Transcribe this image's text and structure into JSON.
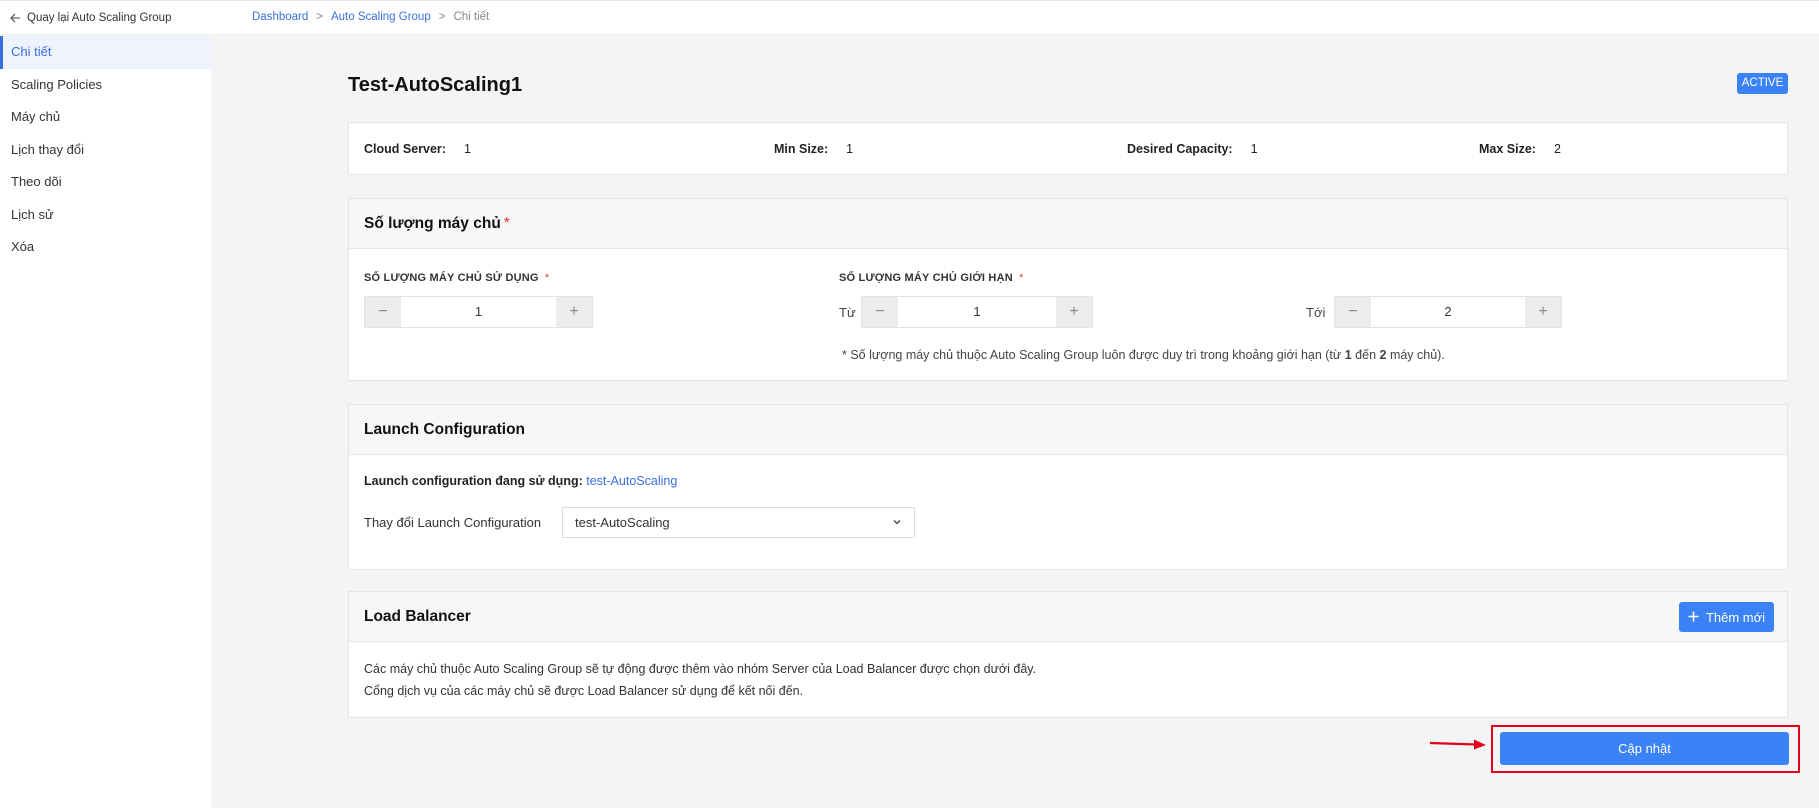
{
  "topbar": {
    "back_label": "Quay lại Auto Scaling Group",
    "breadcrumb": [
      "Dashboard",
      "Auto Scaling Group",
      "Chi tiết"
    ],
    "separator": ">"
  },
  "sidebar": {
    "items": [
      {
        "label": "Chi tiết",
        "active": true
      },
      {
        "label": "Scaling Policies"
      },
      {
        "label": "Máy chủ"
      },
      {
        "label": "Lịch thay đổi"
      },
      {
        "label": "Theo dõi"
      },
      {
        "label": "Lịch sử"
      },
      {
        "label": "Xóa"
      }
    ]
  },
  "page": {
    "title": "Test-AutoScaling1",
    "status": "ACTIVE"
  },
  "stats": {
    "cloud_server_label": "Cloud Server:",
    "cloud_server": "1",
    "min_size_label": "Min Size:",
    "min_size": "1",
    "desired_label": "Desired Capacity:",
    "desired": "1",
    "max_size_label": "Max Size:",
    "max_size": "2"
  },
  "quantity": {
    "title": "Số lượng máy chủ",
    "required_mark": "*",
    "in_use_label": "SỐ LƯỢNG MÁY CHỦ SỬ DỤNG",
    "in_use_value": "1",
    "limit_label": "SỐ LƯỢNG MÁY CHỦ GIỚI HẠN",
    "from_label": "Từ",
    "from_value": "1",
    "to_label": "Tới",
    "to_value": "2",
    "note_prefix": "* Số lượng máy chủ thuộc Auto Scaling Group luôn được duy trì trong khoảng giới hạn (từ ",
    "note_min": "1",
    "note_mid": " đến ",
    "note_max": "2",
    "note_suffix": " máy chủ)."
  },
  "launch": {
    "title": "Launch Configuration",
    "current_label": "Launch configuration đang sử dụng:",
    "current_value": "test-AutoScaling",
    "change_label": "Thay đổi Launch Configuration",
    "selected": "test-AutoScaling"
  },
  "load_balancer": {
    "title": "Load Balancer",
    "add_label": "Thêm mới",
    "line1": "Các máy chủ thuộc Auto Scaling Group sẽ tự động được thêm vào nhóm Server của Load Balancer được chọn dưới đây.",
    "line2": "Cổng dịch vụ của các máy chủ sẽ được Load Balancer sử dụng để kết nối đến."
  },
  "actions": {
    "update_label": "Cập nhật"
  },
  "colors": {
    "accent": "#3b82f6",
    "highlight": "#e3001b"
  },
  "icons": [
    "arrow-left-icon",
    "minus-icon",
    "plus-icon",
    "chevron-down-icon",
    "red-arrow-icon"
  ]
}
